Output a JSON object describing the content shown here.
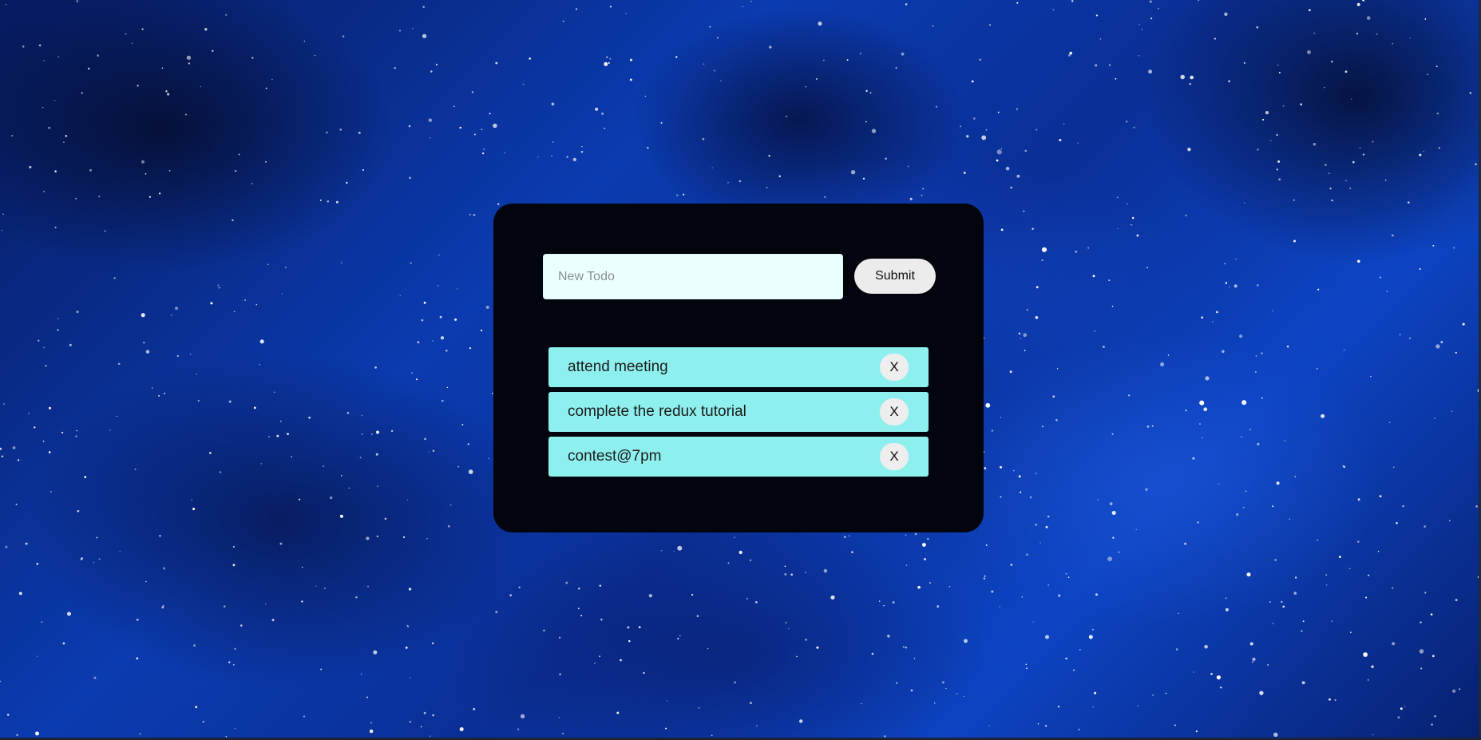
{
  "background": {
    "image": "blue-nebula-marble-texture",
    "base_color": "#0a2a8a"
  },
  "card": {
    "background_color": "#02050e"
  },
  "form": {
    "input_placeholder": "New Todo",
    "input_value": "",
    "submit_label": "Submit"
  },
  "todos": [
    {
      "text": "attend meeting",
      "delete_label": "X"
    },
    {
      "text": "complete the redux tutorial",
      "delete_label": "X"
    },
    {
      "text": "contest@7pm",
      "delete_label": "X"
    }
  ],
  "colors": {
    "todo_item": "#8ef0ee",
    "input_bg": "#eafffe",
    "button_bg": "#ececec"
  }
}
